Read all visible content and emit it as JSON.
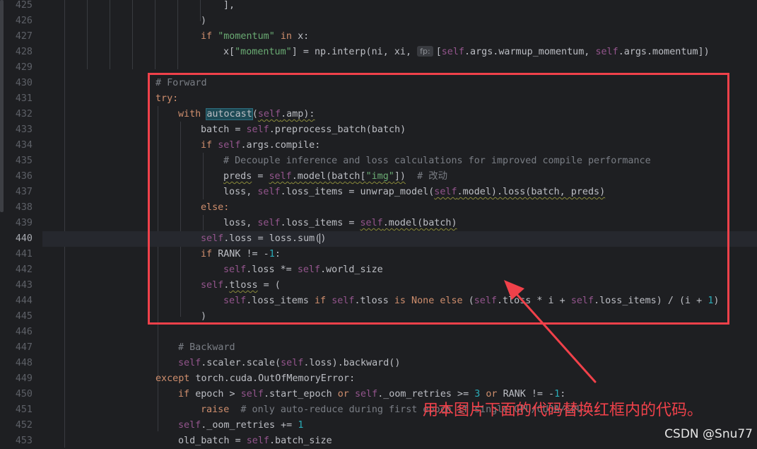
{
  "editor": {
    "line_numbers": [
      "425",
      "426",
      "427",
      "428",
      "429",
      "430",
      "431",
      "432",
      "433",
      "434",
      "435",
      "436",
      "437",
      "438",
      "439",
      "440",
      "441",
      "442",
      "443",
      "444",
      "445",
      "446",
      "447",
      "448",
      "449",
      "450",
      "451",
      "452",
      "453"
    ],
    "current_line": "440",
    "inlay_hint_fp": "fp:",
    "code": {
      "l425": "],",
      "l426": ")",
      "l427_if": "if ",
      "l427_str": "\"momentum\"",
      "l427_in": " in ",
      "l427_rest": "x:",
      "l428_a": "x[",
      "l428_str": "\"momentum\"",
      "l428_b": "] = np.interp(ni, xi, ",
      "l428_c": "[",
      "l428_self1": "self",
      "l428_d": ".args.warmup_momentum, ",
      "l428_self2": "self",
      "l428_e": ".args.momentum])",
      "l430": "# Forward",
      "l431": "try:",
      "l432_with": "with ",
      "l432_fn": "autocast",
      "l432_a": "(",
      "l432_self": "self",
      "l432_b": ".amp):",
      "l433_a": "batch = ",
      "l433_self": "self",
      "l433_b": ".preprocess_batch(batch)",
      "l434_if": "if ",
      "l434_self": "self",
      "l434_b": ".args.compile:",
      "l435": "# Decouple inference and loss calculations for improved compile performance",
      "l436_preds": "preds",
      "l436_a": " = ",
      "l436_self": "self",
      "l436_b": ".model(batch[",
      "l436_str": "\"img\"",
      "l436_c": "])",
      "l436_comment": "  # 改动",
      "l437_a": "loss, ",
      "l437_self1": "self",
      "l437_b": ".loss_items = unwrap_model(",
      "l437_self2": "self",
      "l437_c": ".model).loss(batch, preds)",
      "l438": "else:",
      "l439_a": "loss, ",
      "l439_self1": "self",
      "l439_b": ".loss_items = ",
      "l439_self2": "self",
      "l439_c": ".model(batch)",
      "l440_self": "self",
      "l440_a": ".loss = loss.sum(",
      "l440_b": ")",
      "l441_if": "if ",
      "l441_a": "RANK != -",
      "l441_n": "1",
      "l441_b": ":",
      "l442_self1": "self",
      "l442_a": ".loss *= ",
      "l442_self2": "self",
      "l442_b": ".world_size",
      "l443_self": "self",
      "l443_a": ".",
      "l443_tloss": "tloss",
      "l443_b": " = (",
      "l444_self1": "self",
      "l444_a": ".loss_items ",
      "l444_if": "if ",
      "l444_self2": "self",
      "l444_b": ".tloss ",
      "l444_is": "is None else ",
      "l444_c": "(",
      "l444_self3": "self",
      "l444_d": ".tloss * i + ",
      "l444_self4": "self",
      "l444_e": ".loss_items) / (i + ",
      "l444_n": "1",
      "l444_f": ")",
      "l445": ")",
      "l447": "# Backward",
      "l448_self1": "self",
      "l448_a": ".scaler.scale(",
      "l448_self2": "self",
      "l448_b": ".loss).backward()",
      "l449_except": "except ",
      "l449_a": "torch.cuda.OutOfMemoryError:",
      "l450_if": "if ",
      "l450_a": "epoch > ",
      "l450_self1": "self",
      "l450_b": ".start_epoch ",
      "l450_or1": "or ",
      "l450_self2": "self",
      "l450_c": "._oom_retries >= ",
      "l450_n3": "3",
      "l450_or2": " or ",
      "l450_d": "RANK != -",
      "l450_n1": "1",
      "l450_e": ":",
      "l451_raise": "raise",
      "l451_comment": "  # only auto-reduce during first epoch if single GPU/CUDA/CPU...",
      "l452_self": "self",
      "l452_a": "._oom_retries += ",
      "l452_n": "1",
      "l453_a": "old_batch = ",
      "l453_self": "self",
      "l453_b": ".batch_size"
    }
  },
  "annotation": {
    "text": "用本图片下面的代码替换红框内的代码。",
    "color": "#f0414a"
  },
  "watermark": "CSDN @Snu77",
  "colors": {
    "background": "#1e1f22",
    "keyword": "#cf8e6d",
    "string": "#6aab73",
    "comment": "#7a7e85",
    "self": "#94558d",
    "number": "#2aacb8",
    "highlight_box": "#f0414a"
  }
}
